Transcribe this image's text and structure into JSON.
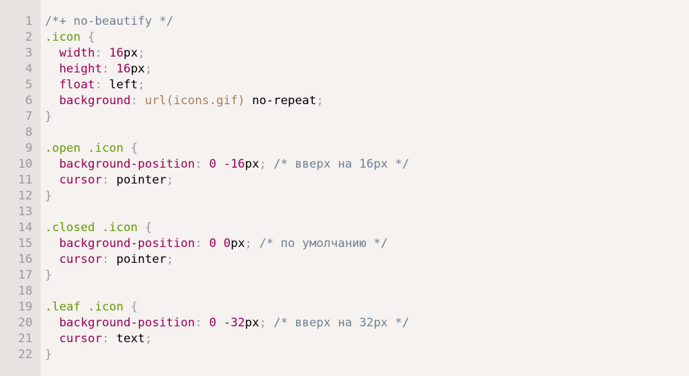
{
  "editor": {
    "language": "css",
    "colors": {
      "background": "#f5f2f0",
      "gutter": "#e6e3e1",
      "line_number": "#999999",
      "comment": "#708090",
      "selector": "#669900",
      "property": "#990055",
      "number": "#990055",
      "punctuation": "#999999",
      "function": "#a67f59",
      "plain": "#000000"
    },
    "lines": [
      {
        "n": "1",
        "tokens": [
          {
            "t": "cm",
            "v": "/*+ no-beautify */"
          }
        ]
      },
      {
        "n": "2",
        "tokens": [
          {
            "t": "sel",
            "v": ".icon "
          },
          {
            "t": "pu",
            "v": "{"
          }
        ]
      },
      {
        "n": "3",
        "tokens": [
          {
            "t": "pl",
            "v": "  "
          },
          {
            "t": "pr",
            "v": "width"
          },
          {
            "t": "pu",
            "v": ": "
          },
          {
            "t": "nu",
            "v": "16"
          },
          {
            "t": "pl",
            "v": "px"
          },
          {
            "t": "pu",
            "v": ";"
          }
        ]
      },
      {
        "n": "4",
        "tokens": [
          {
            "t": "pl",
            "v": "  "
          },
          {
            "t": "pr",
            "v": "height"
          },
          {
            "t": "pu",
            "v": ": "
          },
          {
            "t": "nu",
            "v": "16"
          },
          {
            "t": "pl",
            "v": "px"
          },
          {
            "t": "pu",
            "v": ";"
          }
        ]
      },
      {
        "n": "5",
        "tokens": [
          {
            "t": "pl",
            "v": "  "
          },
          {
            "t": "pr",
            "v": "float"
          },
          {
            "t": "pu",
            "v": ": "
          },
          {
            "t": "pl",
            "v": "left"
          },
          {
            "t": "pu",
            "v": ";"
          }
        ]
      },
      {
        "n": "6",
        "tokens": [
          {
            "t": "pl",
            "v": "  "
          },
          {
            "t": "pr",
            "v": "background"
          },
          {
            "t": "pu",
            "v": ": "
          },
          {
            "t": "fn",
            "v": "url(icons.gif)"
          },
          {
            "t": "pl",
            "v": " no-repeat"
          },
          {
            "t": "pu",
            "v": ";"
          }
        ]
      },
      {
        "n": "7",
        "tokens": [
          {
            "t": "pu",
            "v": "}"
          }
        ]
      },
      {
        "n": "8",
        "tokens": []
      },
      {
        "n": "9",
        "tokens": [
          {
            "t": "sel",
            "v": ".open .icon "
          },
          {
            "t": "pu",
            "v": "{"
          }
        ]
      },
      {
        "n": "10",
        "tokens": [
          {
            "t": "pl",
            "v": "  "
          },
          {
            "t": "pr",
            "v": "background-position"
          },
          {
            "t": "pu",
            "v": ": "
          },
          {
            "t": "nu",
            "v": "0"
          },
          {
            "t": "pl",
            "v": " "
          },
          {
            "t": "nu",
            "v": "-16"
          },
          {
            "t": "pl",
            "v": "px"
          },
          {
            "t": "pu",
            "v": ";"
          },
          {
            "t": "pl",
            "v": " "
          },
          {
            "t": "cm",
            "v": "/* вверх на 16px */"
          }
        ]
      },
      {
        "n": "11",
        "tokens": [
          {
            "t": "pl",
            "v": "  "
          },
          {
            "t": "pr",
            "v": "cursor"
          },
          {
            "t": "pu",
            "v": ": "
          },
          {
            "t": "pl",
            "v": "pointer"
          },
          {
            "t": "pu",
            "v": ";"
          }
        ]
      },
      {
        "n": "12",
        "tokens": [
          {
            "t": "pu",
            "v": "}"
          }
        ]
      },
      {
        "n": "13",
        "tokens": []
      },
      {
        "n": "14",
        "tokens": [
          {
            "t": "sel",
            "v": ".closed .icon "
          },
          {
            "t": "pu",
            "v": "{"
          }
        ]
      },
      {
        "n": "15",
        "tokens": [
          {
            "t": "pl",
            "v": "  "
          },
          {
            "t": "pr",
            "v": "background-position"
          },
          {
            "t": "pu",
            "v": ": "
          },
          {
            "t": "nu",
            "v": "0"
          },
          {
            "t": "pl",
            "v": " "
          },
          {
            "t": "nu",
            "v": "0"
          },
          {
            "t": "pl",
            "v": "px"
          },
          {
            "t": "pu",
            "v": ";"
          },
          {
            "t": "pl",
            "v": " "
          },
          {
            "t": "cm",
            "v": "/* по умолчанию */"
          }
        ]
      },
      {
        "n": "16",
        "tokens": [
          {
            "t": "pl",
            "v": "  "
          },
          {
            "t": "pr",
            "v": "cursor"
          },
          {
            "t": "pu",
            "v": ": "
          },
          {
            "t": "pl",
            "v": "pointer"
          },
          {
            "t": "pu",
            "v": ";"
          }
        ]
      },
      {
        "n": "17",
        "tokens": [
          {
            "t": "pu",
            "v": "}"
          }
        ]
      },
      {
        "n": "18",
        "tokens": []
      },
      {
        "n": "19",
        "tokens": [
          {
            "t": "sel",
            "v": ".leaf .icon "
          },
          {
            "t": "pu",
            "v": "{"
          }
        ]
      },
      {
        "n": "20",
        "tokens": [
          {
            "t": "pl",
            "v": "  "
          },
          {
            "t": "pr",
            "v": "background-position"
          },
          {
            "t": "pu",
            "v": ": "
          },
          {
            "t": "nu",
            "v": "0"
          },
          {
            "t": "pl",
            "v": " "
          },
          {
            "t": "nu",
            "v": "-32"
          },
          {
            "t": "pl",
            "v": "px"
          },
          {
            "t": "pu",
            "v": ";"
          },
          {
            "t": "pl",
            "v": " "
          },
          {
            "t": "cm",
            "v": "/* вверх на 32px */"
          }
        ]
      },
      {
        "n": "21",
        "tokens": [
          {
            "t": "pl",
            "v": "  "
          },
          {
            "t": "pr",
            "v": "cursor"
          },
          {
            "t": "pu",
            "v": ": "
          },
          {
            "t": "pl",
            "v": "text"
          },
          {
            "t": "pu",
            "v": ";"
          }
        ]
      },
      {
        "n": "22",
        "tokens": [
          {
            "t": "pu",
            "v": "}"
          }
        ]
      }
    ]
  }
}
